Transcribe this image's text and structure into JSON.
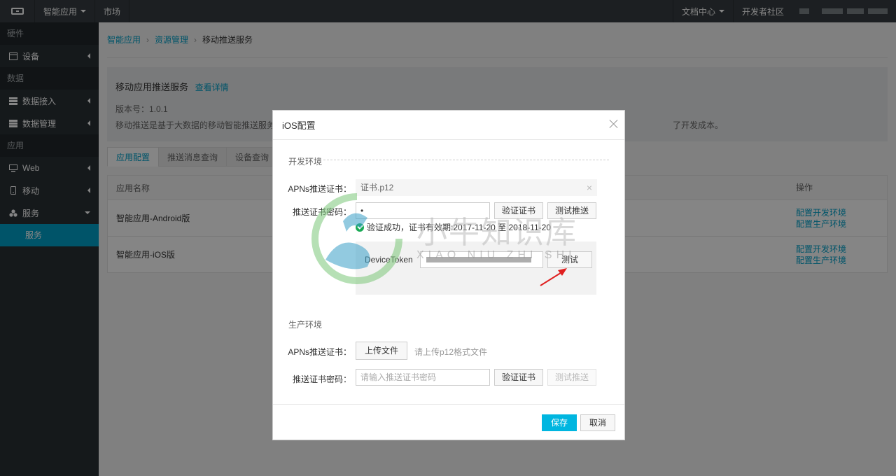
{
  "topbar": {
    "app_menu": "智能应用",
    "market": "市场",
    "docs": "文档中心",
    "community": "开发者社区"
  },
  "sidebar": {
    "groups": {
      "hardware": "硬件",
      "data": "数据",
      "app": "应用"
    },
    "items": {
      "device": "设备",
      "data_access": "数据接入",
      "data_manage": "数据管理",
      "web": "Web",
      "mobile": "移动",
      "service": "服务",
      "service_sub": "服务"
    }
  },
  "breadcrumb": [
    "智能应用",
    "资源管理",
    "移动推送服务"
  ],
  "info": {
    "title": "移动应用推送服务",
    "detail_link": "查看详情",
    "version": "版本号：1.0.1",
    "desc_left": "移动推送是基于大数据的移动智能推送服务",
    "desc_right": "了开发成本。"
  },
  "tabs": [
    "应用配置",
    "推送消息查询",
    "设备查询"
  ],
  "table": {
    "headers": {
      "name": "应用名称",
      "op": "操作"
    },
    "rows": [
      {
        "name": "智能应用-Android版",
        "op1": "配置开发环境",
        "op2": "配置生产环境"
      },
      {
        "name": "智能应用-iOS版",
        "op1": "配置开发环境",
        "op2": "配置生产环境"
      }
    ]
  },
  "modal": {
    "title": "iOS配置",
    "dev_section": "开发环境",
    "apns_label": "APNs推送证书：",
    "cert_file": "证书.p12",
    "pwd_label": "推送证书密码：",
    "pwd_value": "•",
    "verify_btn": "验证证书",
    "test_push_btn": "测试推送",
    "verify_ok": "验证成功，证书有效期:2017-11-20 至 2018-11-20",
    "device_token_label": "DeviceToken",
    "test_btn": "测试",
    "prod_section": "生产环境",
    "upload_btn": "上传文件",
    "upload_hint": "请上传p12格式文件",
    "pwd_placeholder": "请输入推送证书密码",
    "save_btn": "保存",
    "cancel_btn": "取消"
  },
  "watermark": {
    "cn": "小牛知识库",
    "en": "XIAO NIU ZHI SHI"
  },
  "colors": {
    "accent": "#00a2ca",
    "topbar": "#373d41",
    "sidebar": "#293034",
    "primary_button": "#00b6e0",
    "success": "#1aaa55",
    "arrow": "#e02020"
  }
}
